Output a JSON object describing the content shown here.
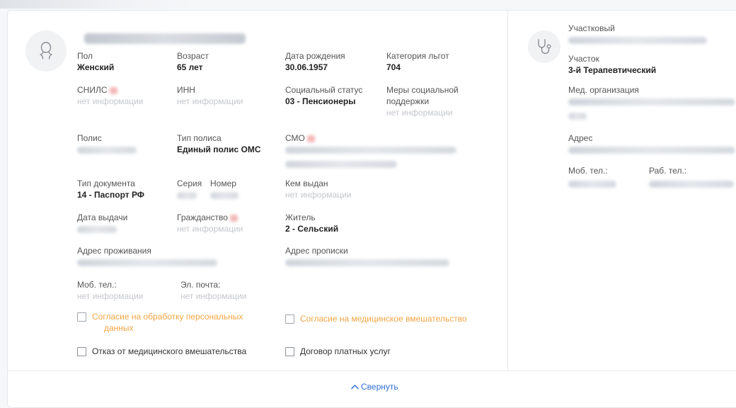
{
  "patient": {
    "fields": {
      "gender": {
        "label": "Пол",
        "value": "Женский"
      },
      "age": {
        "label": "Возраст",
        "value": "65 лет"
      },
      "birth_date": {
        "label": "Дата рождения",
        "value": "30.06.1957"
      },
      "benefit_category": {
        "label": "Категория льгот",
        "value": "704"
      },
      "snils": {
        "label": "СНИЛС",
        "value": "нет информации"
      },
      "inn": {
        "label": "ИНН",
        "value": "нет информации"
      },
      "social_status": {
        "label": "Социальный статус",
        "value": "03 - Пенсионеры"
      },
      "support_measures": {
        "label_line1": "Меры социальной",
        "label_line2": "поддержки",
        "value": "нет информации"
      },
      "policy": {
        "label": "Полис"
      },
      "policy_type": {
        "label": "Тип полиса",
        "value": "Единый полис ОМС"
      },
      "smo": {
        "label": "СМО"
      },
      "doc_type": {
        "label": "Тип документа",
        "value": "14 - Паспорт РФ"
      },
      "series": {
        "label": "Серия"
      },
      "number": {
        "label": "Номер"
      },
      "issued_by": {
        "label": "Кем выдан",
        "value": "нет информации"
      },
      "issue_date": {
        "label": "Дата выдачи"
      },
      "citizenship": {
        "label": "Гражданство",
        "value": "нет информации"
      },
      "resident": {
        "label": "Житель",
        "value": "2 - Сельский"
      },
      "residence_address": {
        "label": "Адрес проживания"
      },
      "registration_address": {
        "label": "Адрес прописки"
      },
      "mobile": {
        "label": "Моб. тел.:",
        "value": "нет информации"
      },
      "email": {
        "label": "Эл. почта:",
        "value": "нет информации"
      }
    },
    "checkboxes": {
      "personal_data_line1": "Согласие на обработку персональных",
      "personal_data_line2": "данных",
      "medical_consent": "Согласие на медицинское вмешательство",
      "medical_refusal": "Отказ от медицинского вмешательства",
      "paid_contract": "Договор платных услуг"
    }
  },
  "doctor": {
    "district_label": "Участковый",
    "section_label": "Участок",
    "section_value": "3-й Терапевтический",
    "org_label": "Мед. организация",
    "address_label": "Адрес",
    "mobile_label": "Моб. тел.:",
    "work_label": "Раб. тел.:"
  },
  "footer": {
    "collapse_label": "Свернуть"
  },
  "colors": {
    "accent": "#2e6fd6",
    "warning": "#f4a545",
    "muted": "#c4c7cc"
  }
}
